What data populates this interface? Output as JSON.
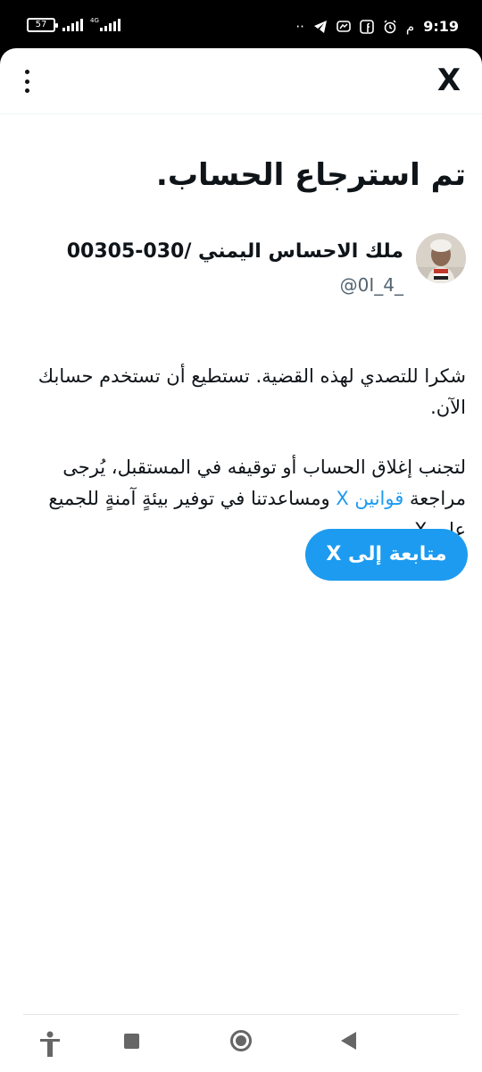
{
  "status_bar": {
    "battery": "57",
    "network": "4G",
    "time": "9:19",
    "ampm": "م",
    "icons": [
      "more-dots-icon",
      "telegram-icon",
      "messenger-icon",
      "facebook-icon",
      "alarm-icon"
    ]
  },
  "header": {
    "menu_icon": "more-vertical-icon",
    "close_label": "X"
  },
  "main": {
    "title": "تم استرجاع الحساب.",
    "user": {
      "name": "ملك الاحساس اليمني /030-00305",
      "handle": "@0I_4_"
    },
    "paragraph1": "شكرا للتصدي لهذه القضية. تستطيع أن تستخدم حسابك الآن.",
    "paragraph2_before": "لتجنب إغلاق الحساب أو توقيفه في المستقبل، يُرجى مراجعة ",
    "paragraph2_link": "قوانين X",
    "paragraph2_after": " ومساعدتنا في توفير بيئةٍ آمنةٍ للجميع على X.",
    "continue_button": "متابعة إلى X"
  },
  "nav_bar": {
    "items": [
      "accessibility-icon",
      "recents-icon",
      "home-icon",
      "back-icon"
    ]
  },
  "colors": {
    "accent": "#1d9bf0",
    "text": "#0f1419",
    "secondary_text": "#536471"
  }
}
